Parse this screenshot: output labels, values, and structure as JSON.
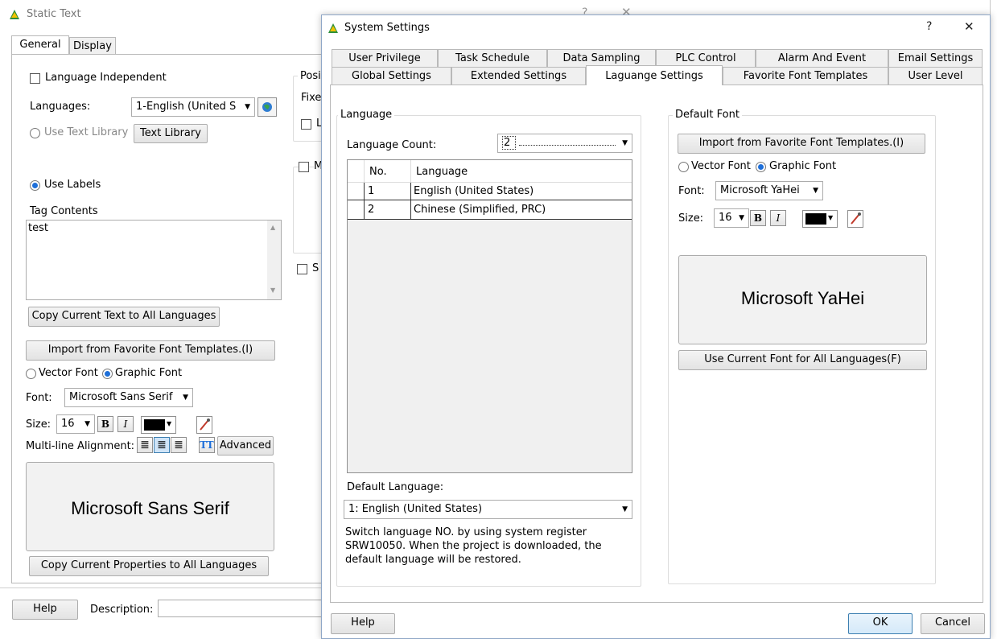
{
  "bg_window": {
    "title": "Static Text",
    "tabs": [
      "General",
      "Display"
    ],
    "language_independent_label": "Language Independent",
    "languages_label": "Languages:",
    "languages_value": "1-English (United S",
    "use_text_library_label": "Use Text Library",
    "text_library_button": "Text Library",
    "use_labels_label": "Use Labels",
    "tag_contents_label": "Tag Contents",
    "tag_contents_value": "test",
    "copy_text_button": "Copy Current Text to All Languages",
    "import_font_button": "Import from Favorite Font Templates.(I)",
    "vector_font_label": "Vector Font",
    "graphic_font_label": "Graphic Font",
    "font_label": "Font:",
    "font_value": "Microsoft Sans Serif",
    "size_label": "Size:",
    "size_value": "16",
    "bold_label": "B",
    "italic_label": "I",
    "alignment_label": "Multi-line Alignment:",
    "tt_label": "TT",
    "advanced_button": "Advanced",
    "font_preview": "Microsoft Sans Serif",
    "copy_props_button": "Copy Current Properties to All Languages",
    "help_button": "Help",
    "description_label": "Description:",
    "position_partial": "Posi",
    "fixed_partial": "Fixe",
    "cb_l_partial": "L",
    "cb_m_partial": "M",
    "cb_s_partial": "S"
  },
  "dialog": {
    "title": "System Settings",
    "help_glyph": "?",
    "close_glyph": "✕",
    "tabs_row1": [
      "User Privilege",
      "Task Schedule",
      "Data Sampling",
      "PLC Control",
      "Alarm And Event",
      "Email Settings"
    ],
    "tabs_row2": [
      "Global Settings",
      "Extended Settings",
      "Laguange Settings",
      "Favorite Font Templates",
      "User Level"
    ],
    "language_group_title": "Language",
    "language_count_label": "Language Count:",
    "language_count_value": "2",
    "table_headers": [
      "No.",
      "Language"
    ],
    "table_rows": [
      {
        "no": "1",
        "language": "English (United States)"
      },
      {
        "no": "2",
        "language": "Chinese (Simplified, PRC)"
      }
    ],
    "default_language_label": "Default Language:",
    "default_language_value": "1: English (United States)",
    "note_text": "Switch language NO. by using system register SRW10050. When the project is downloaded, the default language will be restored.",
    "default_font_title": "Default Font",
    "import_font_button": "Import from Favorite Font Templates.(I)",
    "vector_font_label": "Vector Font",
    "graphic_font_label": "Graphic Font",
    "font_label": "Font:",
    "font_value": "Microsoft YaHei",
    "size_label": "Size:",
    "size_value": "16",
    "bold_label": "B",
    "italic_label": "I",
    "font_preview": "Microsoft YaHei",
    "use_font_all_button": "Use Current Font for All Languages(F)",
    "help_button": "Help",
    "ok_button": "OK",
    "cancel_button": "Cancel"
  },
  "colors": {
    "accent": "#1e6fd9",
    "selection_border": "#3c7fb1"
  }
}
